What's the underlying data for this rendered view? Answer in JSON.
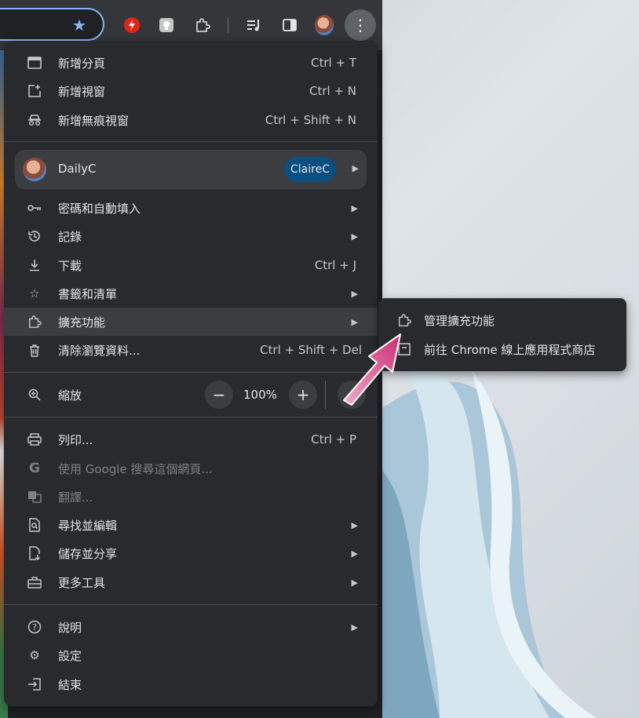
{
  "toolbar": {
    "star_icon": "star-icon",
    "extensions": [
      "lightning-extension-icon",
      "note-extension-icon",
      "puzzle-icon"
    ],
    "right_icons": [
      "media-control-icon",
      "side-panel-icon",
      "avatar",
      "more-vert-icon"
    ]
  },
  "menu": {
    "new_tab": {
      "label": "新增分頁",
      "shortcut": "Ctrl + T"
    },
    "new_window": {
      "label": "新增視窗",
      "shortcut": "Ctrl + N"
    },
    "incognito": {
      "label": "新增無痕視窗",
      "shortcut": "Ctrl + Shift + N"
    },
    "profile": {
      "name": "DailyC",
      "chip": "ClaireC"
    },
    "passwords": {
      "label": "密碼和自動填入"
    },
    "history": {
      "label": "記錄"
    },
    "downloads": {
      "label": "下載",
      "shortcut": "Ctrl + J"
    },
    "bookmarks": {
      "label": "書籤和清單"
    },
    "extensions": {
      "label": "擴充功能"
    },
    "clear_data": {
      "label": "清除瀏覽資料...",
      "shortcut": "Ctrl + Shift + Del"
    },
    "zoom": {
      "label": "縮放",
      "minus": "−",
      "value": "100%",
      "plus": "+"
    },
    "print": {
      "label": "列印...",
      "shortcut": "Ctrl + P"
    },
    "google_search": {
      "label": "使用 Google 搜尋這個網頁..."
    },
    "translate": {
      "label": "翻譯..."
    },
    "find_edit": {
      "label": "尋找並編輯"
    },
    "save_share": {
      "label": "儲存並分享"
    },
    "more_tools": {
      "label": "更多工具"
    },
    "help": {
      "label": "說明"
    },
    "settings": {
      "label": "設定"
    },
    "exit": {
      "label": "結束"
    }
  },
  "submenu": {
    "manage_extensions": "管理擴充功能",
    "chrome_store": "前往 Chrome 線上應用程式商店"
  },
  "colors": {
    "menu_bg": "#292a2d",
    "active_bg": "#3c3d41",
    "chip_bg": "#0b4f80",
    "accent_arrow": "#d9468a"
  }
}
